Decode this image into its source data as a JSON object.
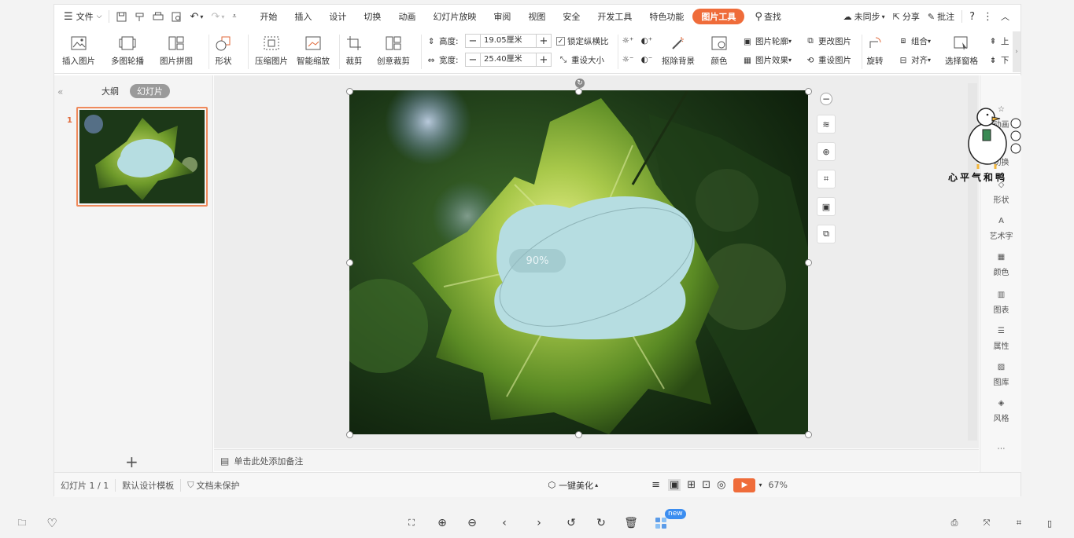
{
  "menubar": {
    "file": "文件",
    "tabs": [
      "开始",
      "插入",
      "设计",
      "切换",
      "动画",
      "幻灯片放映",
      "审阅",
      "视图",
      "安全",
      "开发工具",
      "特色功能"
    ],
    "active_tab": "图片工具",
    "search": "查找",
    "sync": "未同步",
    "share": "分享",
    "comment": "批注"
  },
  "ribbon": {
    "insert_picture": "插入图片",
    "multi_carousel": "多图轮播",
    "picture_collage": "图片拼图",
    "shape": "形状",
    "compress": "压缩图片",
    "smart_zoom": "智能缩放",
    "crop": "裁剪",
    "creative_crop": "创意裁剪",
    "height_label": "高度:",
    "height_value": "19.05厘米",
    "width_label": "宽度:",
    "width_value": "25.40厘米",
    "lock_ratio": "锁定纵横比",
    "reset_size": "重设大小",
    "remove_bg": "抠除背景",
    "color": "颜色",
    "picture_outline": "图片轮廓",
    "picture_effect": "图片效果",
    "change_picture": "更改图片",
    "reset_picture": "重设图片",
    "rotate": "旋转",
    "group": "组合",
    "align": "对齐",
    "selection_pane": "选择窗格",
    "up": "上",
    "down": "下"
  },
  "leftpanel": {
    "outline_tab": "大纲",
    "slides_tab": "幻灯片",
    "slide_number": "1",
    "add": "+"
  },
  "canvas": {
    "zoom_hint": "90%"
  },
  "notes": {
    "placeholder": "单击此处添加备注"
  },
  "rightpanel": {
    "items": [
      "动画",
      "切换",
      "形状",
      "艺术字",
      "颜色",
      "图表",
      "属性",
      "图库",
      "风格"
    ]
  },
  "watermark_text": "心平气和鸭",
  "status": {
    "slide": "幻灯片 1 / 1",
    "template": "默认设计模板",
    "protect": "文档未保护",
    "beautify": "一键美化",
    "zoom": "67%"
  },
  "bottombar": {
    "new_badge": "new"
  },
  "colors": {
    "accent": "#ef6c3a",
    "shape_fill": "#b6dde1",
    "play": "#ef6c3a"
  }
}
